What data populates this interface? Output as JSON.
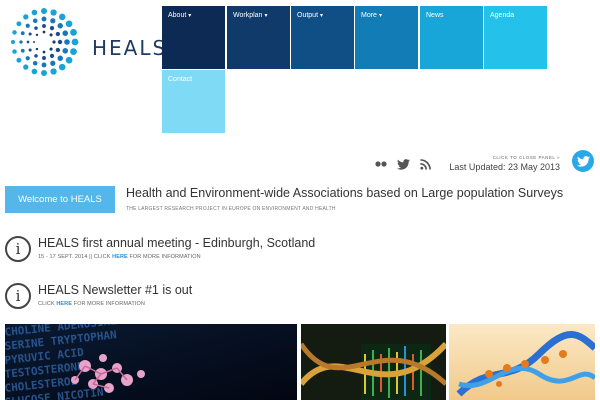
{
  "logo": {
    "text": "HEALS",
    "icon": "dot-circle-logo-icon"
  },
  "nav": {
    "items": [
      {
        "label": "About",
        "has_dropdown": true,
        "color": "#0d2a55"
      },
      {
        "label": "Workplan",
        "has_dropdown": true,
        "color": "#0f3a6a"
      },
      {
        "label": "Output",
        "has_dropdown": true,
        "color": "#0f4f86"
      },
      {
        "label": "More",
        "has_dropdown": true,
        "color": "#117cb6"
      },
      {
        "label": "News",
        "has_dropdown": false,
        "color": "#18a6d8"
      },
      {
        "label": "Agenda",
        "has_dropdown": false,
        "color": "#24c2ea"
      },
      {
        "label": "Contact",
        "has_dropdown": false,
        "color": "#7fdaf5"
      }
    ],
    "caret": "▾"
  },
  "utility": {
    "icons": [
      "flickr-icon",
      "twitter-bird-icon",
      "rss-icon"
    ],
    "close_panel": "CLICK TO CLOSE PANEL »",
    "last_updated": "Last Updated: 23 May 2013",
    "twitter_button_icon": "twitter-icon"
  },
  "welcome": {
    "button_label": "Welcome to HEALS",
    "headline": "Health and Environment-wide Associations based on Large population Surveys",
    "subheadline": "THE LARGEST RESEARCH PROJECT IN EUROPE ON ENVIRONMENT AND HEALTH"
  },
  "news": [
    {
      "title": "HEALS first annual meeting - Edinburgh, Scotland",
      "meta_prefix": "15 - 17 SEPT. 2014 || CLICK ",
      "link_text": "HERE",
      "meta_suffix": " FOR MORE INFORMATION",
      "icon": "info-icon"
    },
    {
      "title": "HEALS Newsletter #1 is out",
      "meta_prefix": "CLICK ",
      "link_text": "HERE",
      "meta_suffix": " FOR MORE INFORMATION",
      "icon": "info-icon"
    }
  ],
  "images": [
    {
      "name": "molecule-text-image"
    },
    {
      "name": "dna-helix-dark-image"
    },
    {
      "name": "dna-helix-light-image"
    }
  ],
  "colors": {
    "accent": "#55b6ea",
    "link": "#2a8ed0",
    "twitter": "#29a9e8"
  }
}
